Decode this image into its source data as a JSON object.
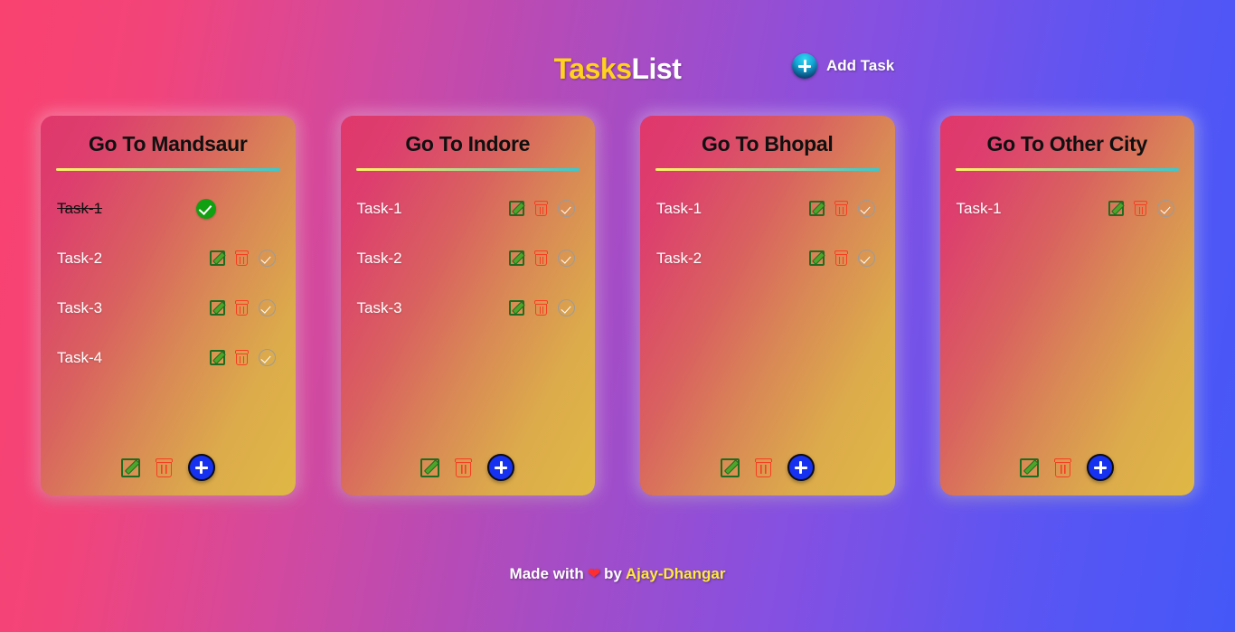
{
  "header": {
    "brand_first": "Tasks",
    "brand_second": "List",
    "add_task_label": "Add Task",
    "add_task_icon": "plus-circle-icon"
  },
  "icons": {
    "edit": "edit-pencil-icon",
    "delete": "trash-icon",
    "check": "check-circle-icon",
    "check_done": "check-circle-filled-icon",
    "add": "plus-circle-icon"
  },
  "board": {
    "cards": [
      {
        "title": "Go To Mandsaur",
        "tasks": [
          {
            "label": "Task-1",
            "completed": true
          },
          {
            "label": "Task-2",
            "completed": false
          },
          {
            "label": "Task-3",
            "completed": false
          },
          {
            "label": "Task-4",
            "completed": false
          }
        ]
      },
      {
        "title": "Go To Indore",
        "tasks": [
          {
            "label": "Task-1",
            "completed": false
          },
          {
            "label": "Task-2",
            "completed": false
          },
          {
            "label": "Task-3",
            "completed": false
          }
        ]
      },
      {
        "title": "Go To Bhopal",
        "tasks": [
          {
            "label": "Task-1",
            "completed": false
          },
          {
            "label": "Task-2",
            "completed": false
          }
        ]
      },
      {
        "title": "Go To Other City",
        "tasks": [
          {
            "label": "Task-1",
            "completed": false
          }
        ]
      }
    ]
  },
  "footer": {
    "made_with": "Made with",
    "heart": "❤",
    "by": "by",
    "author": "Ajay-Dhangar"
  },
  "colors": {
    "brand_accent": "#ffd21e",
    "author_accent": "#ffe93d",
    "edit_icon": "#1f6b1f",
    "delete_icon": "#fa3c20",
    "done_badge": "#11a011",
    "add_button": "#1631f0",
    "bg_start": "#f9426f",
    "bg_end": "#4458f7"
  }
}
